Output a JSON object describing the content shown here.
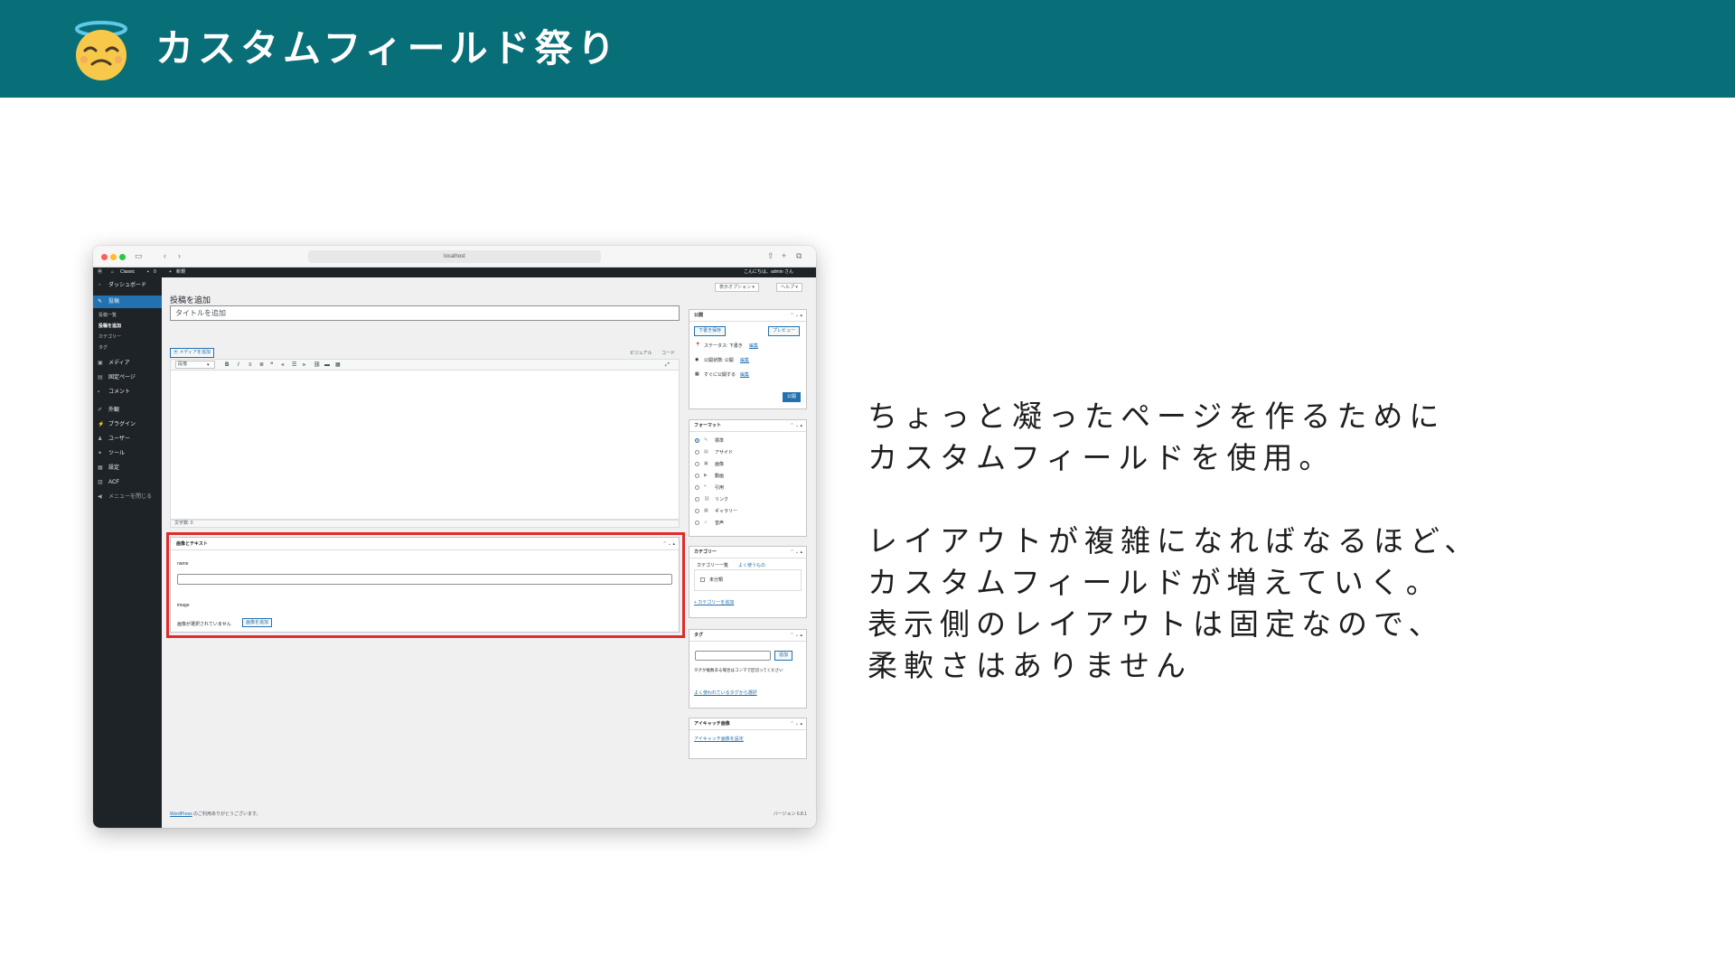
{
  "slide": {
    "title": "カスタムフィールド祭り",
    "emoji_icon": "halo-angel-face-icon",
    "header_color": "#086e78",
    "body_lines": [
      "ちょっと凝ったページを作るために",
      "カスタムフィールドを使用。",
      "レイアウトが複雑になればなるほど、",
      "カスタムフィールドが増えていく。",
      "表示側のレイアウトは固定なので、",
      "柔軟さはありません"
    ]
  },
  "browser": {
    "url": "localhost"
  },
  "admin_bar": {
    "site_name": "Classic",
    "comments_count": "0",
    "new_label": "新規",
    "greeting": "こんにちは、admin さん"
  },
  "sidebar": {
    "items": [
      {
        "label": "ダッシュボード",
        "icon": "dashboard-icon"
      },
      {
        "label": "投稿",
        "icon": "pin-icon"
      },
      {
        "label": "メディア",
        "icon": "media-icon"
      },
      {
        "label": "固定ページ",
        "icon": "page-icon"
      },
      {
        "label": "コメント",
        "icon": "comment-icon"
      },
      {
        "label": "外観",
        "icon": "brush-icon"
      },
      {
        "label": "プラグイン",
        "icon": "plugin-icon"
      },
      {
        "label": "ユーザー",
        "icon": "user-icon"
      },
      {
        "label": "ツール",
        "icon": "wrench-icon"
      },
      {
        "label": "設定",
        "icon": "settings-icon"
      },
      {
        "label": "ACF",
        "icon": "acf-icon"
      },
      {
        "label": "メニューを閉じる",
        "icon": "collapse-icon"
      }
    ],
    "post_submenu": [
      "投稿一覧",
      "投稿を追加",
      "カテゴリー",
      "タグ"
    ]
  },
  "editor": {
    "screen_options": "表示オプション ▾",
    "help": "ヘルプ ▾",
    "page_title": "投稿を追加",
    "title_placeholder": "タイトルを追加",
    "add_media": "メディアを追加",
    "tab_visual": "ビジュアル",
    "tab_code": "コード",
    "paragraph_select": "段落",
    "word_count": "文字数: 0"
  },
  "acf": {
    "group_title": "画像とテキスト",
    "field_name_label": "name",
    "field_image_label": "image",
    "no_image_text": "画像が選択されていません",
    "add_image_button": "画像を追加",
    "highlight_color": "#e02b2b"
  },
  "publish_box": {
    "title": "公開",
    "save_draft": "下書き保存",
    "preview": "プレビュー",
    "status": "ステータス: 下書き",
    "visibility": "公開状態: 公開",
    "schedule": "すぐに公開する",
    "edit_link": "編集",
    "publish_button": "公開"
  },
  "format_box": {
    "title": "フォーマット",
    "options": [
      "標準",
      "アサイド",
      "画像",
      "動画",
      "引用",
      "リンク",
      "ギャラリー",
      "音声"
    ]
  },
  "category_box": {
    "title": "カテゴリー",
    "tab_all": "カテゴリー一覧",
    "tab_popular": "よく使うもの",
    "item": "未分類",
    "add_link": "+ カテゴリーを追加"
  },
  "tag_box": {
    "title": "タグ",
    "add_button": "追加",
    "hint": "タグが複数ある場合はコンマで区切ってください",
    "choose_link": "よく使われているタグから選択"
  },
  "featured_box": {
    "title": "アイキャッチ画像",
    "set_link": "アイキャッチ画像を設定"
  },
  "footer": {
    "wp_link": "WordPress",
    "thanks": " のご利用ありがとうございます。",
    "version": "バージョン 6.8.1"
  }
}
